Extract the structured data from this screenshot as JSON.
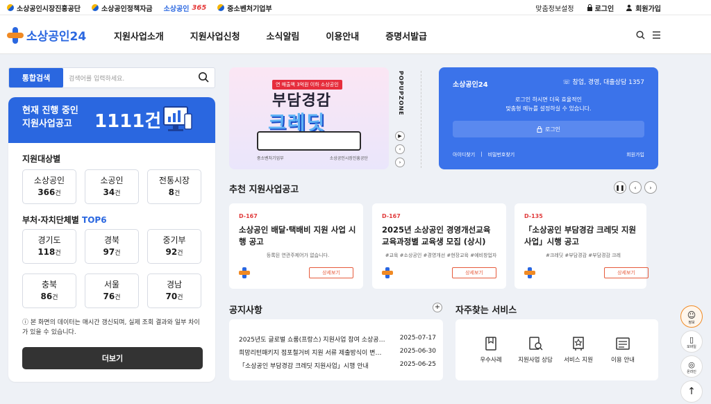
{
  "topbar": {
    "sites": [
      "소상공인시장진흥공단",
      "소상공인정책자금",
      "소상공인",
      "365",
      "중소벤처기업부"
    ],
    "links": {
      "custom": "맞춤정보설정",
      "login": "로그인",
      "join": "회원가입"
    }
  },
  "header": {
    "logo": "소상공인24",
    "menu": [
      "지원사업소개",
      "지원사업신청",
      "소식알림",
      "이용안내",
      "증명서발급"
    ]
  },
  "search": {
    "button": "통합검색",
    "placeholder": "검색어를 입력하세요."
  },
  "banner": {
    "line1": "현재 진행 중인",
    "line2": "지원사업공고",
    "count": "1111건"
  },
  "target": {
    "title": "지원대상별",
    "items": [
      {
        "name": "소상공인",
        "count": "366",
        "unit": "건"
      },
      {
        "name": "소공인",
        "count": "34",
        "unit": "건"
      },
      {
        "name": "전통시장",
        "count": "8",
        "unit": "건"
      }
    ]
  },
  "region": {
    "title": "부처·자치단체별",
    "highlight": "TOP6",
    "items": [
      {
        "name": "경기도",
        "count": "118",
        "unit": "건"
      },
      {
        "name": "경북",
        "count": "97",
        "unit": "건"
      },
      {
        "name": "중기부",
        "count": "92",
        "unit": "건"
      },
      {
        "name": "충북",
        "count": "86",
        "unit": "건"
      },
      {
        "name": "서울",
        "count": "76",
        "unit": "건"
      },
      {
        "name": "경남",
        "count": "70",
        "unit": "건"
      }
    ]
  },
  "note": "본 화면의 데이터는 매시간 갱신되며, 실제 조회 결과와 일부 차이가 있을 수 있습니다.",
  "more_button": "더보기",
  "popup": {
    "tag": "연 매출액 3억원 이하 소상공인",
    "h1": "부담경감",
    "h2": "크레딧",
    "foot_left": "중소벤처기업부",
    "foot_right": "소상공인시장진흥공단",
    "zone": "POPUPZONE"
  },
  "login_box": {
    "title": "소상공인24",
    "contact": "창업, 경영, 대출상담 1357",
    "msg1": "로그인 하시면 더욱 효율적인",
    "msg2": "맞춤형 메뉴를 설정하실 수 있습니다.",
    "button": "로그인",
    "find_id": "아이디찾기",
    "find_pw": "비밀번호찾기",
    "join": "회원가입"
  },
  "recommend": {
    "title": "추천 지원사업공고",
    "cards": [
      {
        "dday": "D-167",
        "title": "소상공인 배달·택배비 지원 사업 시행 공고",
        "tags": "등록된 연관주제어가 없습니다.",
        "btn": "상세보기"
      },
      {
        "dday": "D-167",
        "title": "2025년 소상공인 경영개선교육 교육과정별 교육생 모집 (상시)",
        "tags": "#교육   #소상공인   #경영개선   #현장교육   #예비창업자",
        "btn": "상세보기"
      },
      {
        "dday": "D-135",
        "title": "「소상공인 부담경감 크레딧 지원사업」시행 공고",
        "tags": "#크레딧   #부담경감   #부담경감 크레",
        "btn": "상세보기"
      }
    ]
  },
  "notice": {
    "title": "공지사항",
    "rows": [
      {
        "title": "2025년도 글로벌 쇼룸(프랑스) 지원사업 참여 소상공인 모집 공고",
        "date": "2025-07-17"
      },
      {
        "title": "희망리턴패키지 점포철거비 지원 서류 제출방식이 변경됩니다",
        "date": "2025-06-30"
      },
      {
        "title": "「소상공인 부담경감 크레딧 지원사업」시행 안내",
        "date": "2025-06-25"
      }
    ]
  },
  "services": {
    "title": "자주찾는 서비스",
    "items": [
      "우수사례",
      "지원사업 상담",
      "서비스 지원",
      "이용 안내"
    ]
  },
  "floating": [
    "정보",
    "모바일",
    "온라인"
  ],
  "colors": {
    "primary": "#2a67e0",
    "accent": "#e0393a"
  }
}
